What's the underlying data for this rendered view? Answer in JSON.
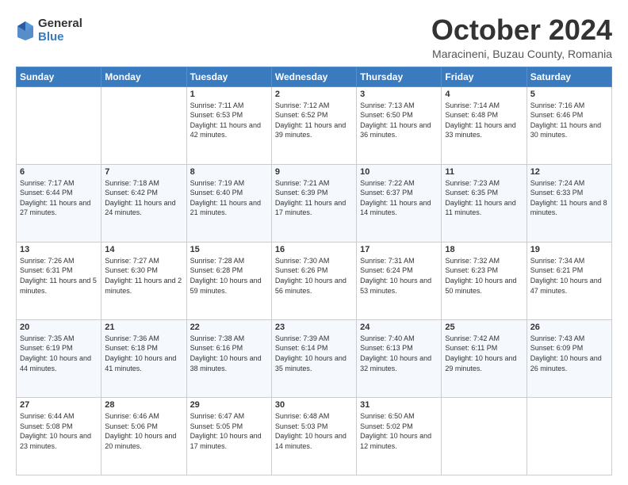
{
  "logo": {
    "general": "General",
    "blue": "Blue"
  },
  "header": {
    "month": "October 2024",
    "location": "Maracineni, Buzau County, Romania"
  },
  "days_of_week": [
    "Sunday",
    "Monday",
    "Tuesday",
    "Wednesday",
    "Thursday",
    "Friday",
    "Saturday"
  ],
  "weeks": [
    [
      {
        "day": "",
        "info": ""
      },
      {
        "day": "",
        "info": ""
      },
      {
        "day": "1",
        "info": "Sunrise: 7:11 AM\nSunset: 6:53 PM\nDaylight: 11 hours and 42 minutes."
      },
      {
        "day": "2",
        "info": "Sunrise: 7:12 AM\nSunset: 6:52 PM\nDaylight: 11 hours and 39 minutes."
      },
      {
        "day": "3",
        "info": "Sunrise: 7:13 AM\nSunset: 6:50 PM\nDaylight: 11 hours and 36 minutes."
      },
      {
        "day": "4",
        "info": "Sunrise: 7:14 AM\nSunset: 6:48 PM\nDaylight: 11 hours and 33 minutes."
      },
      {
        "day": "5",
        "info": "Sunrise: 7:16 AM\nSunset: 6:46 PM\nDaylight: 11 hours and 30 minutes."
      }
    ],
    [
      {
        "day": "6",
        "info": "Sunrise: 7:17 AM\nSunset: 6:44 PM\nDaylight: 11 hours and 27 minutes."
      },
      {
        "day": "7",
        "info": "Sunrise: 7:18 AM\nSunset: 6:42 PM\nDaylight: 11 hours and 24 minutes."
      },
      {
        "day": "8",
        "info": "Sunrise: 7:19 AM\nSunset: 6:40 PM\nDaylight: 11 hours and 21 minutes."
      },
      {
        "day": "9",
        "info": "Sunrise: 7:21 AM\nSunset: 6:39 PM\nDaylight: 11 hours and 17 minutes."
      },
      {
        "day": "10",
        "info": "Sunrise: 7:22 AM\nSunset: 6:37 PM\nDaylight: 11 hours and 14 minutes."
      },
      {
        "day": "11",
        "info": "Sunrise: 7:23 AM\nSunset: 6:35 PM\nDaylight: 11 hours and 11 minutes."
      },
      {
        "day": "12",
        "info": "Sunrise: 7:24 AM\nSunset: 6:33 PM\nDaylight: 11 hours and 8 minutes."
      }
    ],
    [
      {
        "day": "13",
        "info": "Sunrise: 7:26 AM\nSunset: 6:31 PM\nDaylight: 11 hours and 5 minutes."
      },
      {
        "day": "14",
        "info": "Sunrise: 7:27 AM\nSunset: 6:30 PM\nDaylight: 11 hours and 2 minutes."
      },
      {
        "day": "15",
        "info": "Sunrise: 7:28 AM\nSunset: 6:28 PM\nDaylight: 10 hours and 59 minutes."
      },
      {
        "day": "16",
        "info": "Sunrise: 7:30 AM\nSunset: 6:26 PM\nDaylight: 10 hours and 56 minutes."
      },
      {
        "day": "17",
        "info": "Sunrise: 7:31 AM\nSunset: 6:24 PM\nDaylight: 10 hours and 53 minutes."
      },
      {
        "day": "18",
        "info": "Sunrise: 7:32 AM\nSunset: 6:23 PM\nDaylight: 10 hours and 50 minutes."
      },
      {
        "day": "19",
        "info": "Sunrise: 7:34 AM\nSunset: 6:21 PM\nDaylight: 10 hours and 47 minutes."
      }
    ],
    [
      {
        "day": "20",
        "info": "Sunrise: 7:35 AM\nSunset: 6:19 PM\nDaylight: 10 hours and 44 minutes."
      },
      {
        "day": "21",
        "info": "Sunrise: 7:36 AM\nSunset: 6:18 PM\nDaylight: 10 hours and 41 minutes."
      },
      {
        "day": "22",
        "info": "Sunrise: 7:38 AM\nSunset: 6:16 PM\nDaylight: 10 hours and 38 minutes."
      },
      {
        "day": "23",
        "info": "Sunrise: 7:39 AM\nSunset: 6:14 PM\nDaylight: 10 hours and 35 minutes."
      },
      {
        "day": "24",
        "info": "Sunrise: 7:40 AM\nSunset: 6:13 PM\nDaylight: 10 hours and 32 minutes."
      },
      {
        "day": "25",
        "info": "Sunrise: 7:42 AM\nSunset: 6:11 PM\nDaylight: 10 hours and 29 minutes."
      },
      {
        "day": "26",
        "info": "Sunrise: 7:43 AM\nSunset: 6:09 PM\nDaylight: 10 hours and 26 minutes."
      }
    ],
    [
      {
        "day": "27",
        "info": "Sunrise: 6:44 AM\nSunset: 5:08 PM\nDaylight: 10 hours and 23 minutes."
      },
      {
        "day": "28",
        "info": "Sunrise: 6:46 AM\nSunset: 5:06 PM\nDaylight: 10 hours and 20 minutes."
      },
      {
        "day": "29",
        "info": "Sunrise: 6:47 AM\nSunset: 5:05 PM\nDaylight: 10 hours and 17 minutes."
      },
      {
        "day": "30",
        "info": "Sunrise: 6:48 AM\nSunset: 5:03 PM\nDaylight: 10 hours and 14 minutes."
      },
      {
        "day": "31",
        "info": "Sunrise: 6:50 AM\nSunset: 5:02 PM\nDaylight: 10 hours and 12 minutes."
      },
      {
        "day": "",
        "info": ""
      },
      {
        "day": "",
        "info": ""
      }
    ]
  ]
}
